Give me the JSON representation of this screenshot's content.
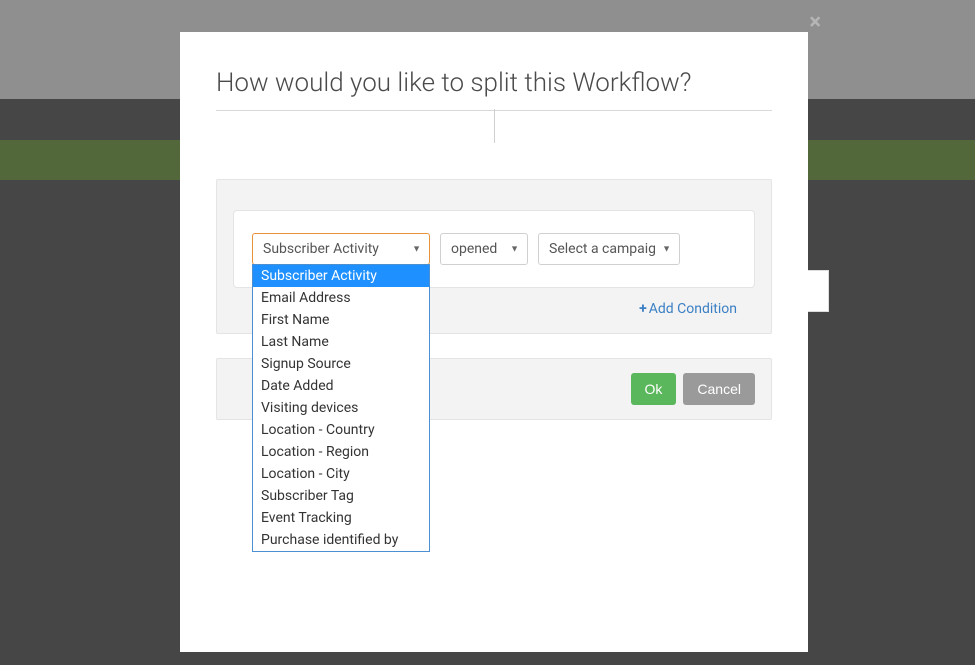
{
  "modal": {
    "title": "How would you like to split this Workflow?",
    "close_icon": "×"
  },
  "condition": {
    "field_select": {
      "value": "Subscriber Activity",
      "options": [
        "Subscriber Activity",
        "Email Address",
        "First Name",
        "Last Name",
        "Signup Source",
        "Date Added",
        "Visiting devices",
        "Location - Country",
        "Location - Region",
        "Location - City",
        "Subscriber Tag",
        "Event Tracking",
        "Purchase identified by"
      ],
      "selected_index": 0
    },
    "operator_select": {
      "value": "opened"
    },
    "campaign_select": {
      "value": "Select a campaign"
    },
    "add_condition_label": "Add Condition"
  },
  "footer": {
    "ok_label": "Ok",
    "cancel_label": "Cancel"
  }
}
